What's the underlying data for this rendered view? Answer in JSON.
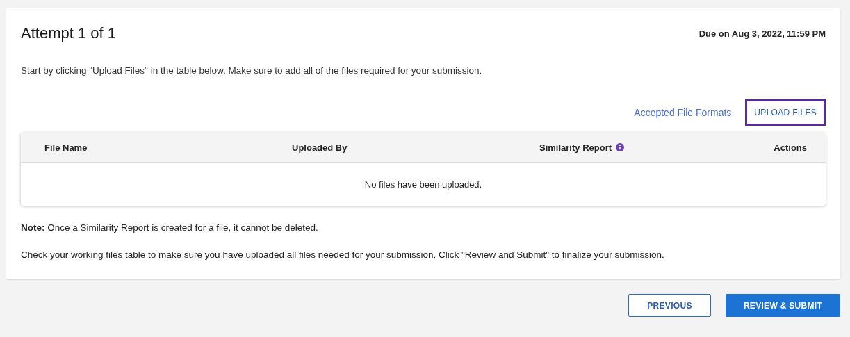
{
  "title": "Attempt 1 of 1",
  "due": "Due on Aug 3, 2022, 11:59 PM",
  "instruction": "Start by clicking \"Upload Files\" in the table below. Make sure to add all of the files required for your submission.",
  "formats_link": "Accepted File Formats",
  "upload_button": {
    "label": "UPLOAD FILES",
    "focused": true
  },
  "table": {
    "columns": [
      {
        "label": "File Name",
        "info": false
      },
      {
        "label": "Uploaded By",
        "info": false
      },
      {
        "label": "Similarity Report",
        "info": true
      },
      {
        "label": "Actions",
        "info": false
      }
    ],
    "empty_message": "No files have been uploaded."
  },
  "note": "**Note:** Once a Similarity Report is created for a file, it cannot be deleted.",
  "check_text": "Check your working files table to make sure you have uploaded all files needed for your submission. Click \"Review and Submit\" to finalize your submission.",
  "buttons": [
    {
      "label": "PREVIOUS",
      "kind": "secondary"
    },
    {
      "label": "REVIEW & SUBMIT",
      "kind": "primary"
    }
  ]
}
